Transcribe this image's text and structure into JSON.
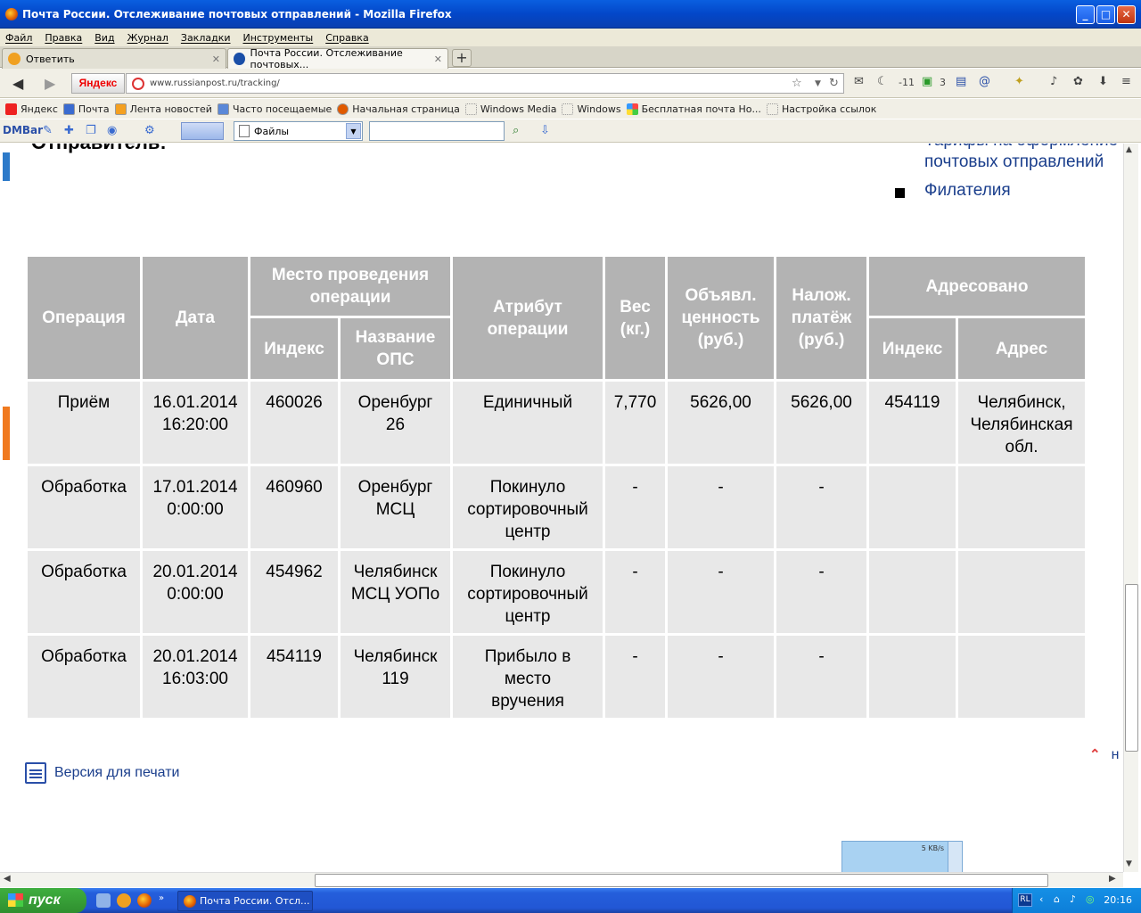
{
  "window": {
    "title": "Почта России. Отслеживание почтовых отправлений - Mozilla Firefox"
  },
  "menu": [
    "Файл",
    "Правка",
    "Вид",
    "Журнал",
    "Закладки",
    "Инструменты",
    "Справка"
  ],
  "tabs": [
    {
      "label": "Ответить",
      "active": false
    },
    {
      "label": "Почта России. Отслеживание почтовых...",
      "active": true
    }
  ],
  "navbar": {
    "yandex_label": "Яндекс",
    "url": "www.russianpost.ru/tracking/",
    "mail_count": "-11",
    "other_count": "3"
  },
  "bookmarks": [
    "Яндекс",
    "Почта",
    "Лента новостей",
    "Часто посещаемые",
    "Начальная страница",
    "Windows Media",
    "Windows",
    "Бесплатная почта Но...",
    "Настройка ссылок"
  ],
  "dmbar": {
    "label": "DMBar",
    "select_value": "Файлы"
  },
  "page": {
    "sender_heading": "Отправитель:",
    "right_link_partial": "Тарифы на оформление",
    "right_link_1": "почтовых отправлений",
    "right_link_2": "Филателия",
    "print_link": "Версия для печати",
    "top_link": "н"
  },
  "table": {
    "headers": {
      "operation": "Операция",
      "date": "Дата",
      "place": "Место проведения операции",
      "place_index": "Индекс",
      "place_name": "Название ОПС",
      "attribute": "Атрибут операции",
      "weight": "Вес (кг.)",
      "declared_value": "Объявл. ценность (руб.)",
      "cod": "Налож. платёж (руб.)",
      "addressed": "Адресовано",
      "addr_index": "Индекс",
      "addr_address": "Адрес"
    },
    "rows": [
      {
        "operation": "Приём",
        "date": "16.01.2014",
        "time": "16:20:00",
        "index": "460026",
        "ops1": "Оренбург",
        "ops2": "26",
        "attr1": "Единичный",
        "attr2": "",
        "attr3": "",
        "weight": "7,770",
        "value": "5626,00",
        "cod": "5626,00",
        "addr_index": "454119",
        "addr1": "Челябинск,",
        "addr2": "Челябинская",
        "addr3": "обл."
      },
      {
        "operation": "Обработка",
        "date": "17.01.2014",
        "time": "0:00:00",
        "index": "460960",
        "ops1": "Оренбург",
        "ops2": "МСЦ",
        "attr1": "Покинуло",
        "attr2": "сортировочный",
        "attr3": "центр",
        "weight": "-",
        "value": "-",
        "cod": "-",
        "addr_index": "",
        "addr1": "",
        "addr2": "",
        "addr3": ""
      },
      {
        "operation": "Обработка",
        "date": "20.01.2014",
        "time": "0:00:00",
        "index": "454962",
        "ops1": "Челябинск",
        "ops2": "МСЦ УОПо",
        "attr1": "Покинуло",
        "attr2": "сортировочный",
        "attr3": "центр",
        "weight": "-",
        "value": "-",
        "cod": "-",
        "addr_index": "",
        "addr1": "",
        "addr2": "",
        "addr3": ""
      },
      {
        "operation": "Обработка",
        "date": "20.01.2014",
        "time": "16:03:00",
        "index": "454119",
        "ops1": "Челябинск",
        "ops2": "119",
        "attr1": "Прибыло в",
        "attr2": "место",
        "attr3": "вручения",
        "weight": "-",
        "value": "-",
        "cod": "-",
        "addr_index": "",
        "addr1": "",
        "addr2": "",
        "addr3": ""
      }
    ]
  },
  "speed_widget": "5 KB/s",
  "taskbar": {
    "start_label": "пуск",
    "task_label": "Почта России. Отсл...",
    "lang": "RL",
    "clock": "20:16"
  }
}
